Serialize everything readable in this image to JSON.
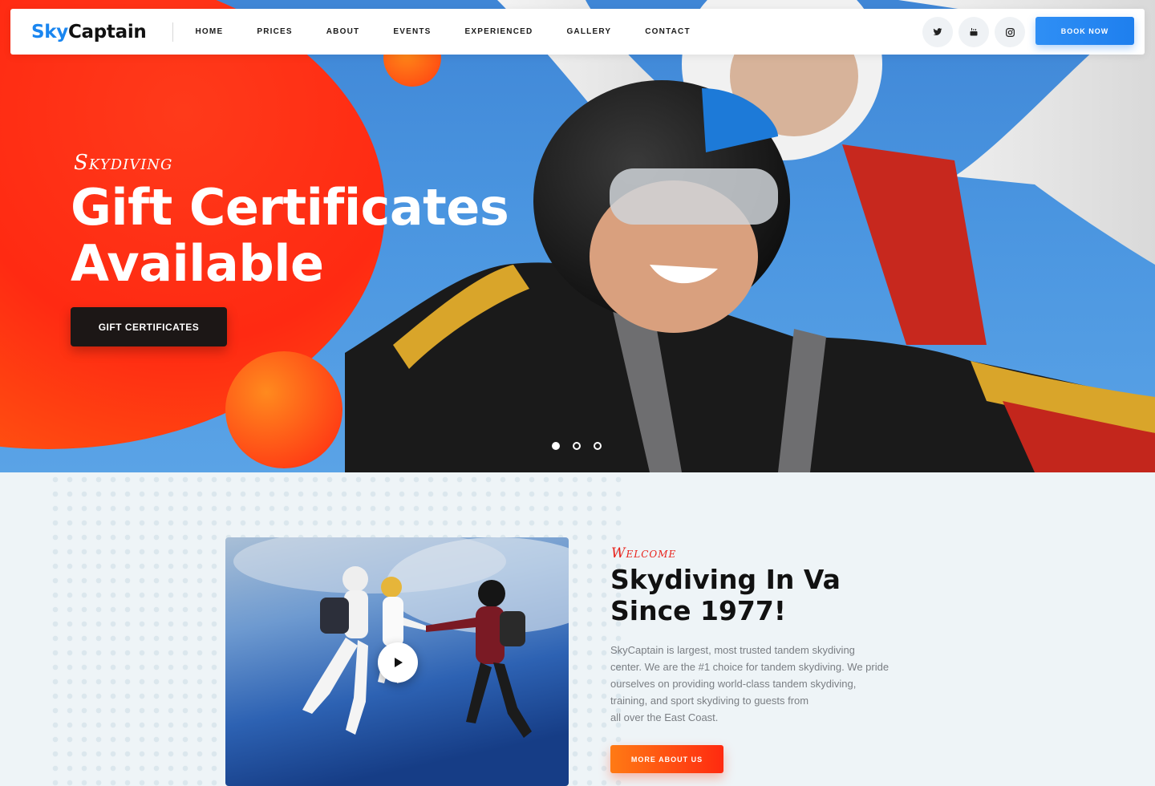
{
  "header": {
    "logo_sky": "Sky",
    "logo_captain": "Captain",
    "nav": [
      "HOME",
      "PRICES",
      "ABOUT",
      "EVENTS",
      "EXPERIENCED",
      "GALLERY",
      "CONTACT"
    ],
    "socials": [
      "twitter-icon",
      "youtube-icon",
      "instagram-icon"
    ],
    "book_label": "BOOK NOW"
  },
  "hero": {
    "kicker": "Skydiving",
    "title_line1": "Gift Certificates",
    "title_line2": "Available",
    "button_label": "GIFT CERTIFICATES",
    "slides": 3,
    "active_slide": 1
  },
  "about": {
    "kicker": "Welcome",
    "title_line1": "Skydiving In Va",
    "title_line2": "Since 1977!",
    "text_lines": [
      "SkyCaptain is largest, most trusted tandem skydiving",
      "center. We are the #1 choice for tandem skydiving. We pride",
      "ourselves on providing world-class tandem skydiving,",
      "training, and sport skydiving to guests from",
      "all over the East Coast."
    ],
    "button_label": "MORE ABOUT US"
  },
  "colors": {
    "brand_blue": "#1a86f0",
    "accent_red": "#ff2a12",
    "accent_orange": "#ff7a14",
    "dark": "#1c1716"
  }
}
